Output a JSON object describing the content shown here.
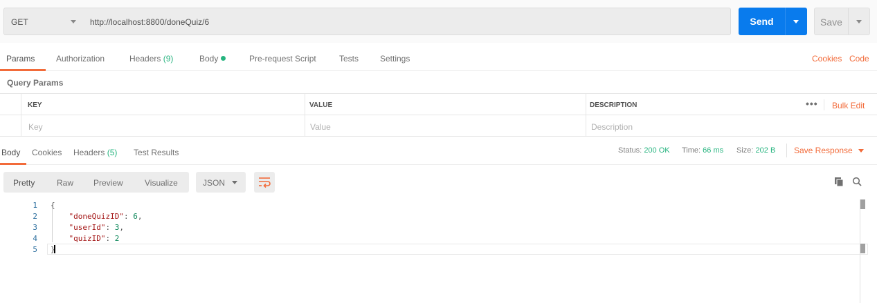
{
  "request": {
    "method": "GET",
    "url": "http://localhost:8800/doneQuiz/6",
    "send_label": "Send",
    "save_label": "Save"
  },
  "request_tabs": {
    "params": "Params",
    "authorization": "Authorization",
    "headers": "Headers",
    "headers_count": "(9)",
    "body": "Body",
    "prerequest": "Pre-request Script",
    "tests": "Tests",
    "settings": "Settings",
    "cookies": "Cookies",
    "code": "Code"
  },
  "query_params": {
    "title": "Query Params",
    "columns": {
      "key": "KEY",
      "value": "VALUE",
      "description": "DESCRIPTION"
    },
    "placeholders": {
      "key": "Key",
      "value": "Value",
      "description": "Description"
    },
    "more": "•••",
    "bulk_edit": "Bulk Edit"
  },
  "response_tabs": {
    "body": "Body",
    "cookies": "Cookies",
    "headers": "Headers",
    "headers_count": "(5)",
    "test_results": "Test Results"
  },
  "response_status": {
    "status_label": "Status:",
    "status_value": "200 OK",
    "time_label": "Time:",
    "time_value": "66 ms",
    "size_label": "Size:",
    "size_value": "202 B",
    "save_response": "Save Response"
  },
  "view_modes": {
    "pretty": "Pretty",
    "raw": "Raw",
    "preview": "Preview",
    "visualize": "Visualize",
    "format": "JSON"
  },
  "icons": {
    "wrap": "wrap-lines-icon",
    "copy": "copy-icon",
    "search": "search-icon"
  },
  "colors": {
    "accent": "#f26b3a",
    "send": "#097bed",
    "success": "#26b47f"
  },
  "editor": {
    "line_numbers": [
      "1",
      "2",
      "3",
      "4",
      "5"
    ],
    "lines": {
      "l1": "{",
      "l2_key": "\"doneQuizID\"",
      "l2_val": "6",
      "l3_key": "\"userId\"",
      "l3_val": "3",
      "l4_key": "\"quizID\"",
      "l4_val": "2",
      "l5": "}"
    }
  }
}
